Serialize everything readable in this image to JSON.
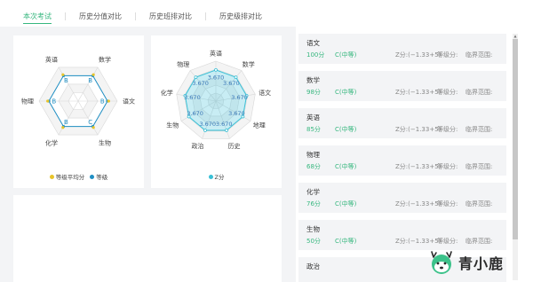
{
  "tabs": [
    "本次考试",
    "历史分值对比",
    "历史班排对比",
    "历史级排对比"
  ],
  "radar1": {
    "subjects": [
      "数学",
      "语文",
      "生物",
      "化学",
      "物理",
      "英语"
    ],
    "grades": [
      "B",
      "B",
      "C",
      "B",
      "B",
      "B"
    ],
    "legend": [
      "等级平均分",
      "等级"
    ],
    "colors": {
      "avg": "#e8c42a",
      "grade": "#1f8fc4"
    }
  },
  "radar2": {
    "subjects": [
      "英语",
      "数学",
      "语文",
      "地理",
      "历史",
      "政治",
      "生物",
      "化学",
      "物理"
    ],
    "values": [
      "3.670",
      "3.670",
      "3.670",
      "3.670",
      "3.670",
      "3.670",
      "3.670",
      "3.670",
      "3.670"
    ],
    "legend": [
      "Z分"
    ],
    "colors": {
      "z": "#39c0d6"
    }
  },
  "scores": [
    {
      "subject": "语文",
      "value": "100分",
      "grade": "C(中等)",
      "z": "Z分:(−1.33+5)",
      "level": "等级分:",
      "range": "临界范围:"
    },
    {
      "subject": "数学",
      "value": "98分",
      "grade": "C(中等)",
      "z": "Z分:(−1.33+5)",
      "level": "等级分:",
      "range": "临界范围:"
    },
    {
      "subject": "英语",
      "value": "85分",
      "grade": "C(中等)",
      "z": "Z分:(−1.33+5)",
      "level": "等级分:",
      "range": "临界范围:"
    },
    {
      "subject": "物理",
      "value": "68分",
      "grade": "C(中等)",
      "z": "Z分:(−1.33+5)",
      "level": "等级分:",
      "range": "临界范围:"
    },
    {
      "subject": "化学",
      "value": "76分",
      "grade": "C(中等)",
      "z": "Z分:(−1.33+5)",
      "level": "等级分:",
      "range": "临界范围:"
    },
    {
      "subject": "生物",
      "value": "50分",
      "grade": "C(中等)",
      "z": "Z分:(−1.33+5)",
      "level": "等级分:",
      "range": "临界范围:"
    },
    {
      "subject": "政治",
      "value": "",
      "grade": "",
      "z": "",
      "level": "",
      "range": ""
    }
  ],
  "brand": {
    "name": "青小鹿"
  },
  "accent": "#37b77f"
}
